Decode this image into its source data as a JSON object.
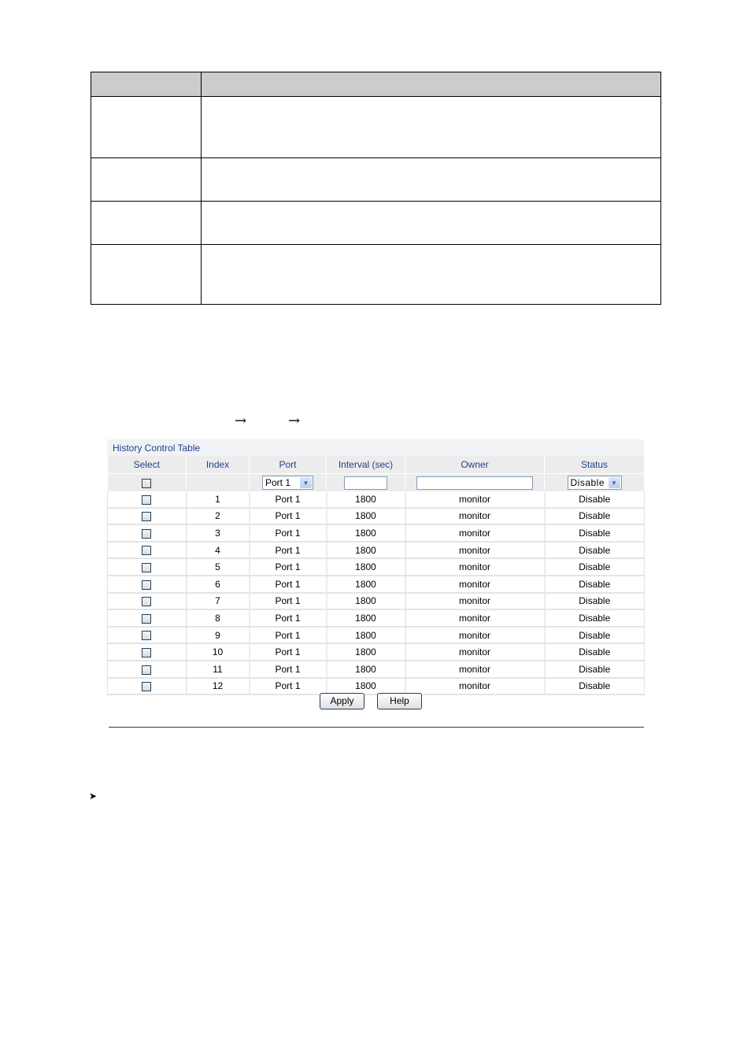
{
  "doc_table": {
    "rows": 5
  },
  "nav_path": {
    "separators": [
      "→",
      "→"
    ]
  },
  "history_control": {
    "title": "History Control Table",
    "columns": [
      "Select",
      "Index",
      "Port",
      "Interval (sec)",
      "Owner",
      "Status"
    ],
    "filter": {
      "port_selected": "Port 1",
      "interval_value": "",
      "owner_value": "",
      "status_selected": "Disable"
    },
    "rows": [
      {
        "index": "1",
        "port": "Port 1",
        "interval": "1800",
        "owner": "monitor",
        "status": "Disable"
      },
      {
        "index": "2",
        "port": "Port 1",
        "interval": "1800",
        "owner": "monitor",
        "status": "Disable"
      },
      {
        "index": "3",
        "port": "Port 1",
        "interval": "1800",
        "owner": "monitor",
        "status": "Disable"
      },
      {
        "index": "4",
        "port": "Port 1",
        "interval": "1800",
        "owner": "monitor",
        "status": "Disable"
      },
      {
        "index": "5",
        "port": "Port 1",
        "interval": "1800",
        "owner": "monitor",
        "status": "Disable"
      },
      {
        "index": "6",
        "port": "Port 1",
        "interval": "1800",
        "owner": "monitor",
        "status": "Disable"
      },
      {
        "index": "7",
        "port": "Port 1",
        "interval": "1800",
        "owner": "monitor",
        "status": "Disable"
      },
      {
        "index": "8",
        "port": "Port 1",
        "interval": "1800",
        "owner": "monitor",
        "status": "Disable"
      },
      {
        "index": "9",
        "port": "Port 1",
        "interval": "1800",
        "owner": "monitor",
        "status": "Disable"
      },
      {
        "index": "10",
        "port": "Port 1",
        "interval": "1800",
        "owner": "monitor",
        "status": "Disable"
      },
      {
        "index": "11",
        "port": "Port 1",
        "interval": "1800",
        "owner": "monitor",
        "status": "Disable"
      },
      {
        "index": "12",
        "port": "Port 1",
        "interval": "1800",
        "owner": "monitor",
        "status": "Disable"
      }
    ],
    "buttons": {
      "apply": "Apply",
      "help": "Help"
    }
  },
  "bullet": {
    "glyph": "➤"
  }
}
